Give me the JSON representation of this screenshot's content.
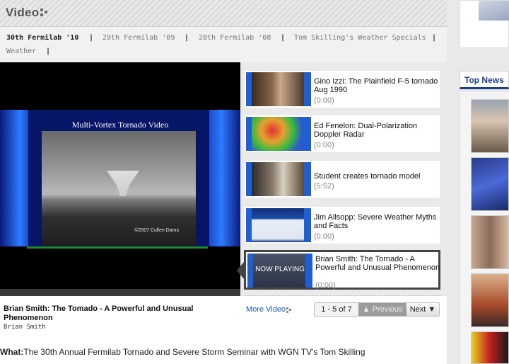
{
  "header": {
    "title": "Video"
  },
  "categories": [
    {
      "label": "30th Fermilab '10",
      "active": true
    },
    {
      "label": "29th Fermilab '09",
      "active": false
    },
    {
      "label": "28th Fermilab '08",
      "active": false
    },
    {
      "label": "Tom Skilling's Weather Specials",
      "active": false
    },
    {
      "label": "Weather",
      "active": false
    }
  ],
  "separator": "|",
  "player": {
    "slide_caption": "Multi-Vortex Tornado Video",
    "copyright": "©2007 Cullen Dams"
  },
  "playlist": [
    {
      "title": "Gino Izzi: The Plainfield F-5 tornado Aug 1990",
      "duration": "(0:00)"
    },
    {
      "title": "Ed Fenelon: Dual-Polarization Doppler Radar",
      "duration": "(0:00)"
    },
    {
      "title": "Student creates tornado model",
      "duration": "(5:52)"
    },
    {
      "title": "Jim Allsopp: Severe Weather Myths and Facts",
      "duration": "(0:00)"
    },
    {
      "title": "Brian Smith: The Tornado - A Powerful and Unusual Phenomenon",
      "duration": "(0:00)",
      "now_playing": true
    }
  ],
  "now_playing_label": "NOW PLAYING",
  "current_video": {
    "title": "Brian Smith: The Tomado - A Powerful and Unusual Phenomenon",
    "author": "Brian Smith"
  },
  "more_video_label": "More Video",
  "pager": {
    "count": "1 - 5 of 7",
    "previous": "Previous",
    "next": "Next"
  },
  "what": {
    "label": "What:",
    "text": "The 30th Annual Fermilab Tornado and Severe Storm Seminar with WGN TV's Tom Skilling"
  },
  "right_column": {
    "top_news_label": "Top News"
  },
  "colors": {
    "accent_blue": "#1a3f8a",
    "link_blue": "#1a56b5",
    "slide_blue": "#2d7cff"
  }
}
